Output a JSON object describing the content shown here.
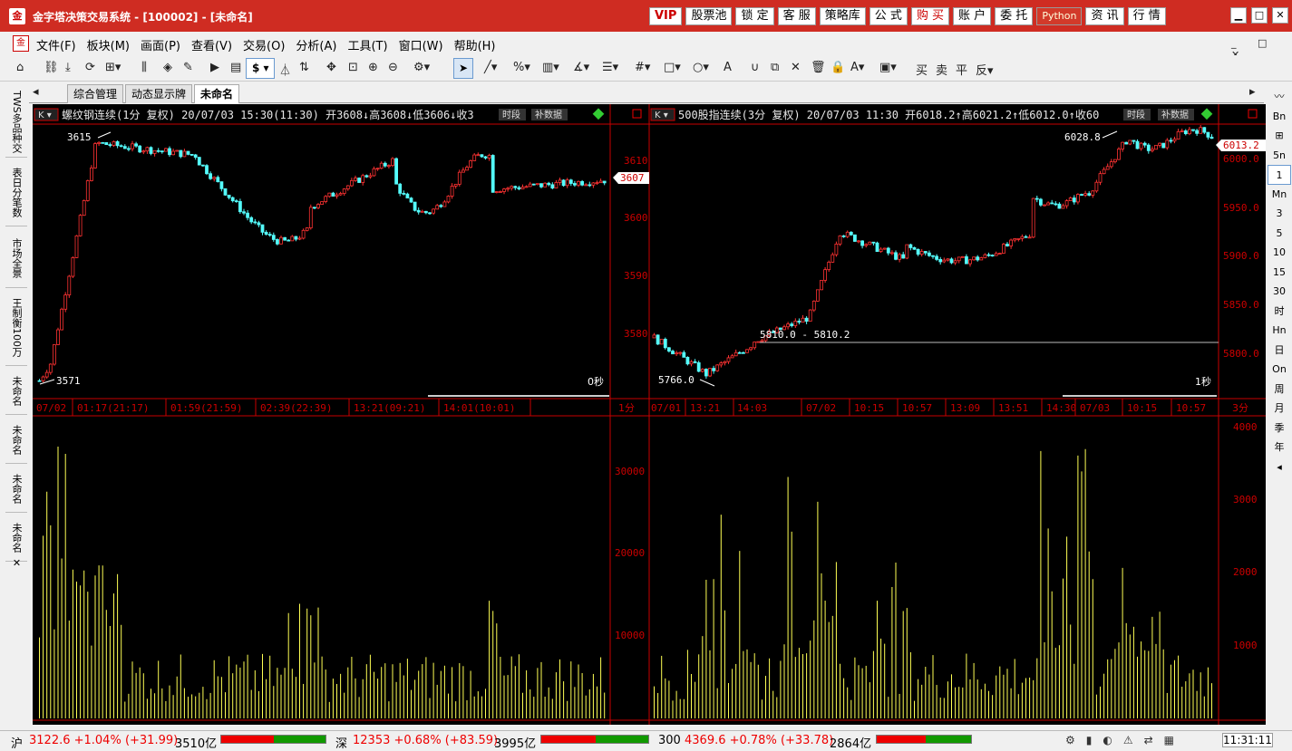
{
  "title_bar": {
    "app_title": "金字塔决策交易系统 - [100002] - [未命名]",
    "buttons": [
      "VIP",
      "股票池",
      "锁 定",
      "客 服",
      "策略库",
      "公 式",
      "购 买",
      "账 户",
      "委 托",
      "Python",
      "资 讯",
      "行 情"
    ],
    "window_controls": [
      "▁",
      "□",
      "✕"
    ]
  },
  "menu": {
    "items": [
      "文件(F)",
      "板块(M)",
      "画面(P)",
      "查看(V)",
      "交易(O)",
      "分析(A)",
      "工具(T)",
      "窗口(W)",
      "帮助(H)"
    ],
    "right_controls": "_ □ ✕"
  },
  "tabs": {
    "items": [
      "综合管理",
      "动态显示牌",
      "未命名"
    ],
    "active": 2
  },
  "left_tabs": [
    "TWS多品种交",
    "表日分笔数",
    "市场全景",
    "王制衡100万",
    "未命名",
    "未命名",
    "未命名",
    "未命名"
  ],
  "left_close": "✕",
  "periods": [
    "Bn",
    "⊞",
    "5n",
    "1",
    "Mn",
    "3",
    "5",
    "10",
    "15",
    "30",
    "时",
    "Hn",
    "日",
    "On",
    "周",
    "月",
    "季",
    "年",
    "◂"
  ],
  "left_chart": {
    "header": "螺纹钢连续(1分 复权) 20/07/03 15:30(11:30) 开3608↓高3608↓低3606↓收3",
    "btn_period": "时段",
    "btn_fill": "补数据",
    "high_label": "3615",
    "low_label": "3571",
    "price_ticks": [
      "3610",
      "3600",
      "3590",
      "3580"
    ],
    "last_price": "3607",
    "timer": "0秒",
    "time_axis": [
      "07/02",
      "01:17(21:17)",
      "01:59(21:59)",
      "02:39(22:39)",
      "13:21(09:21)",
      "14:01(10:01)"
    ],
    "period_label": "1分",
    "vol_ticks": [
      "30000",
      "20000",
      "10000"
    ]
  },
  "right_chart": {
    "header": "500股指连续(3分 复权) 20/07/03 11:30 开6018.2↑高6021.2↑低6012.0↑收60",
    "btn_period": "时段",
    "btn_fill": "补数据",
    "high_label": "6028.8",
    "low_label": "5766.0",
    "mid_label": "5810.0 - 5810.2",
    "price_ticks": [
      "6000.0",
      "5950.0",
      "5900.0",
      "5850.0",
      "5800.0"
    ],
    "last_price": "6013.2",
    "timer": "1秒",
    "time_axis": [
      "07/01",
      "13:21",
      "14:03",
      "07/02",
      "10:15",
      "10:57",
      "13:09",
      "13:51",
      "14:30",
      "07/03",
      "10:15",
      "10:57"
    ],
    "period_label": "3分",
    "vol_ticks": [
      "4000",
      "3000",
      "2000",
      "1000"
    ]
  },
  "status_bar": {
    "sh_label": "沪",
    "sh_index": "3122.6 +1.04% (+31.99)",
    "sh_amount": "3510亿",
    "sz_label": "深",
    "sz_index": "12353 +0.68% (+83.59)",
    "sz_amount": "3995亿",
    "c300_label": "300",
    "c300_index": "4369.6 +0.78% (+33.78)",
    "c300_amount": "2864亿",
    "clock": "11:31:11"
  },
  "colors": {
    "up": "#ff3232",
    "down": "#54fcfc",
    "volume": "#ffff54",
    "axis": "#c80000"
  }
}
